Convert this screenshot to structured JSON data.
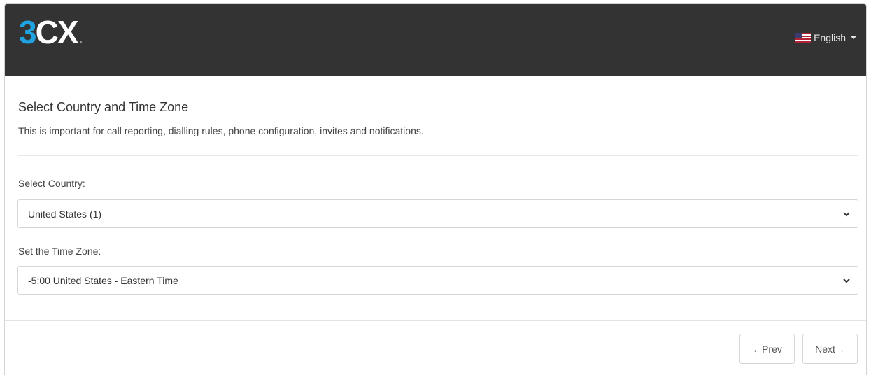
{
  "header": {
    "logo_text": "3CX",
    "language": {
      "flag": "us-flag-icon",
      "label": "English"
    }
  },
  "main": {
    "title": "Select Country and Time Zone",
    "subtitle": "This is important for call reporting, dialling rules, phone configuration, invites and notifications.",
    "country": {
      "label": "Select Country:",
      "value": "United States (1)"
    },
    "timezone": {
      "label": "Set the Time Zone:",
      "value": "-5:00 United States - Eastern Time"
    }
  },
  "footer": {
    "prev_label": "←Prev",
    "next_label": "Next→"
  },
  "colors": {
    "header_bg": "#333333",
    "logo_accent": "#1fa2e0"
  }
}
